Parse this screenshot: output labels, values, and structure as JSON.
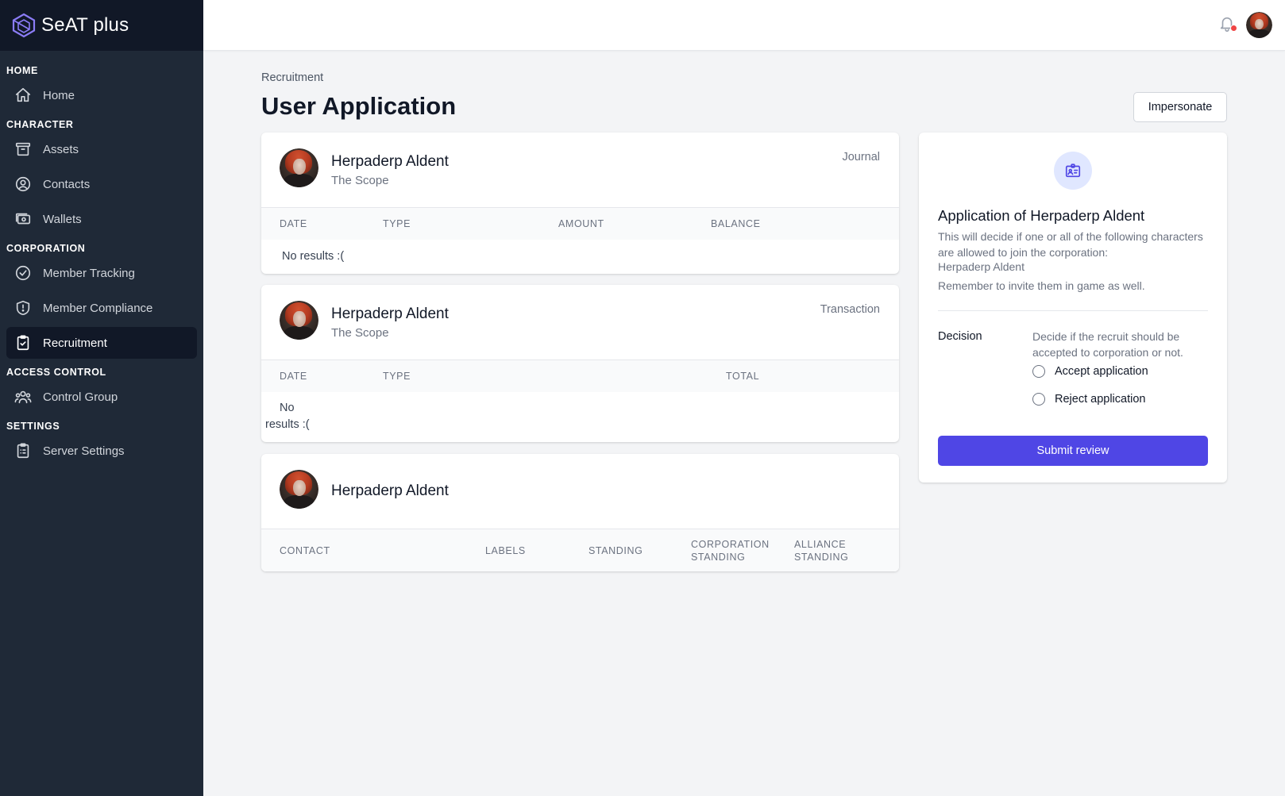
{
  "app": {
    "name": "SeAT plus"
  },
  "sidebar": {
    "sections": [
      {
        "title": "HOME",
        "items": [
          {
            "label": "Home",
            "icon": "home-icon"
          }
        ]
      },
      {
        "title": "CHARACTER",
        "items": [
          {
            "label": "Assets",
            "icon": "archive-icon"
          },
          {
            "label": "Contacts",
            "icon": "user-circle-icon"
          },
          {
            "label": "Wallets",
            "icon": "cash-icon"
          }
        ]
      },
      {
        "title": "CORPORATION",
        "items": [
          {
            "label": "Member Tracking",
            "icon": "badge-check-icon"
          },
          {
            "label": "Member Compliance",
            "icon": "shield-check-icon"
          },
          {
            "label": "Recruitment",
            "icon": "clipboard-check-icon",
            "active": true
          }
        ]
      },
      {
        "title": "ACCESS CONTROL",
        "items": [
          {
            "label": "Control Group",
            "icon": "user-group-icon"
          }
        ]
      },
      {
        "title": "SETTINGS",
        "items": [
          {
            "label": "Server Settings",
            "icon": "clipboard-list-icon"
          }
        ]
      }
    ]
  },
  "header": {
    "breadcrumb": "Recruitment",
    "title": "User Application",
    "impersonate_label": "Impersonate"
  },
  "cards": {
    "journal": {
      "name": "Herpaderp Aldent",
      "corporation": "The Scope",
      "tag": "Journal",
      "columns": [
        "DATE",
        "TYPE",
        "AMOUNT",
        "BALANCE"
      ],
      "empty": "No results :("
    },
    "transaction": {
      "name": "Herpaderp Aldent",
      "corporation": "The Scope",
      "tag": "Transaction",
      "columns": [
        "DATE",
        "TYPE",
        "TOTAL"
      ],
      "empty_line1": "No",
      "empty_line2": "results :("
    },
    "contacts": {
      "name": "Herpaderp Aldent",
      "columns": [
        "CONTACT",
        "LABELS",
        "STANDING",
        "CORPORATION",
        "STANDING",
        "ALLIANCE",
        "STANDING"
      ]
    }
  },
  "review": {
    "title": "Application of Herpaderp Aldent",
    "description": "This will decide if one or all of the following characters are allowed to join the corporation:",
    "characters": "Herpaderp Aldent",
    "reminder": "Remember to invite them in game as well.",
    "decision_label": "Decision",
    "decision_help": "Decide if the recruit should be accepted to corporation or not.",
    "accept_label": "Accept application",
    "reject_label": "Reject application",
    "submit_label": "Submit review"
  },
  "colors": {
    "sidebar": "#1f2937",
    "brand_bar": "#111827",
    "accent": "#4f46e5",
    "notification_dot": "#ef4444"
  }
}
